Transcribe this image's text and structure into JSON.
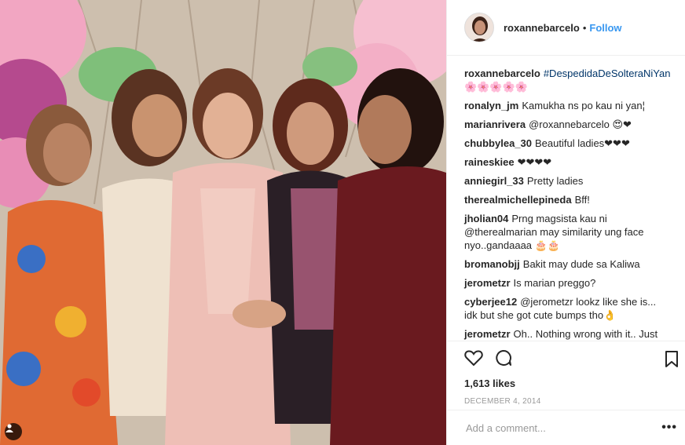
{
  "post": {
    "author": "roxannebarcelo",
    "separator": "•",
    "follow_label": "Follow",
    "caption": {
      "user": "roxannebarcelo",
      "text": "#DespedidaDeSolteraNiYan 🌸🌸🌸🌸🌸"
    },
    "comments": [
      {
        "user": "ronalyn_jm",
        "text": "Kamukha ns po kau ni yan¦"
      },
      {
        "user": "marianrivera",
        "text": "@roxannebarcelo 😍❤"
      },
      {
        "user": "chubbylea_30",
        "text": "Beautiful ladies❤❤❤"
      },
      {
        "user": "raineskiee",
        "text": "❤❤❤❤"
      },
      {
        "user": "anniegirl_33",
        "text": "Pretty ladies"
      },
      {
        "user": "therealmichellepineda",
        "text": "Bff!"
      },
      {
        "user": "jholian04",
        "text": "Prng magsista kau ni @therealmarian may similarity ung face nyo..gandaaaa 🎂🎂"
      },
      {
        "user": "bromanobjj",
        "text": "Bakit may dude sa Kaliwa"
      },
      {
        "user": "jerometzr",
        "text": "Is marian preggo?"
      },
      {
        "user": "cyberjee12",
        "text": "@jerometzr lookz like she is... idk but she got cute bumps tho👌"
      },
      {
        "user": "jerometzr",
        "text": "Oh.. Nothing wrong with it.. Just asking"
      }
    ],
    "likes": "1,613 likes",
    "date": "DECEMBER 4, 2014",
    "add_comment_placeholder": "Add a comment...",
    "more_label": "•••"
  },
  "colors": {
    "accent": "#3897f0",
    "text": "#262626",
    "muted": "#999999",
    "border": "#efefef"
  },
  "icons": [
    "heart-icon",
    "comment-icon",
    "bookmark-icon",
    "user-tag-icon"
  ]
}
